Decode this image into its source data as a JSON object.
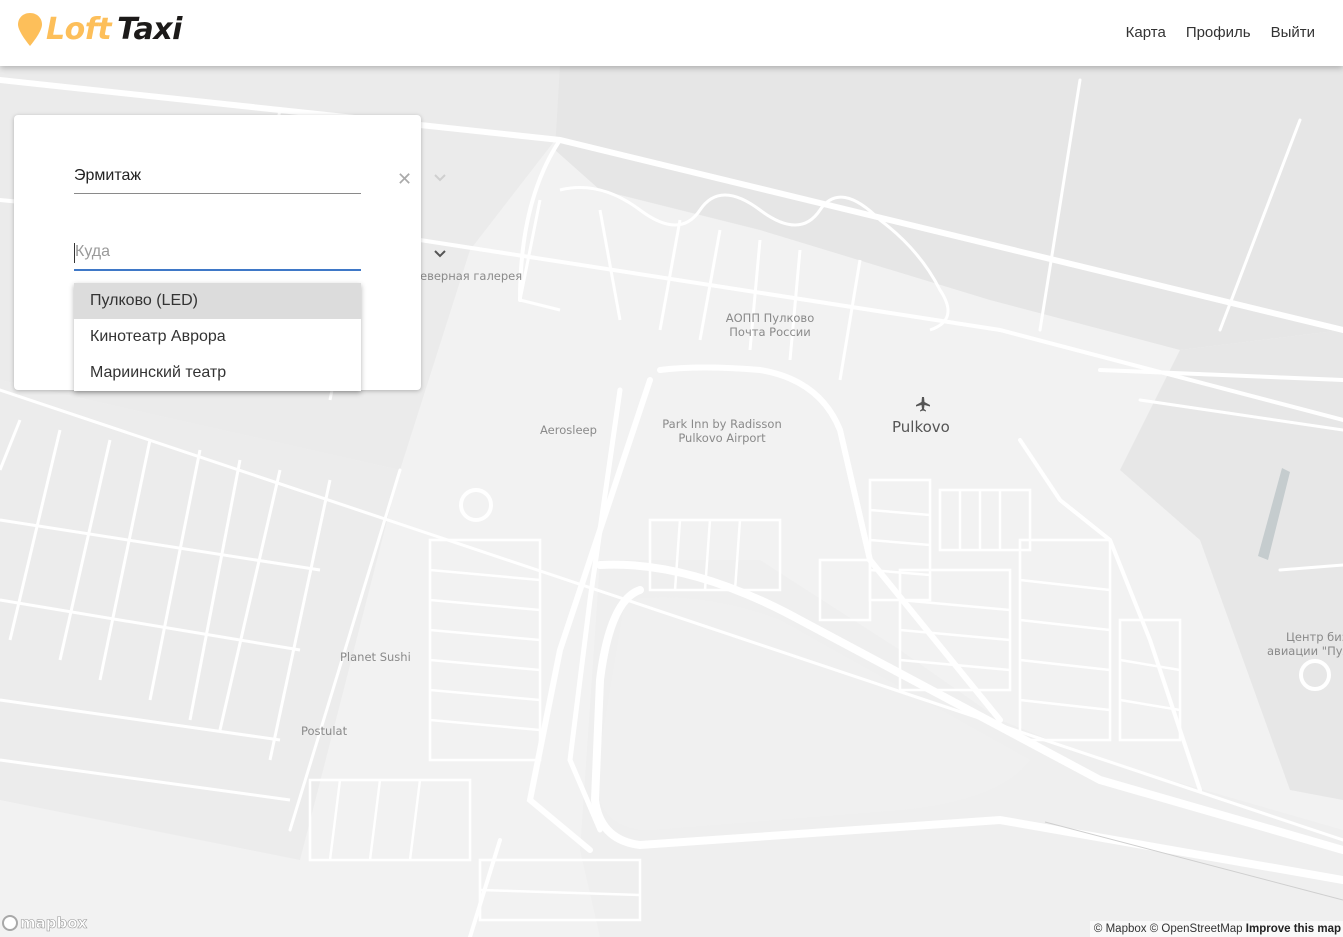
{
  "header": {
    "logo": {
      "loft": "Loft",
      "taxi": "Taxi"
    },
    "nav": [
      {
        "label": "Карта"
      },
      {
        "label": "Профиль"
      },
      {
        "label": "Выйти"
      }
    ]
  },
  "order": {
    "from_value": "Эрмитаж",
    "to_placeholder": "Куда",
    "suggestions": [
      "Пулково (LED)",
      "Кинотеатр Аврора",
      "Мариинский театр"
    ]
  },
  "map": {
    "labels": {
      "gallery": "еверная галерея",
      "post_office_line1": "АОПП Пулково",
      "post_office_line2": "Почта России",
      "airport": "Pulkovo",
      "park_inn_line1": "Park Inn by Radisson",
      "park_inn_line2": "Pulkovo Airport",
      "aerosleep": "Aerosleep",
      "planet_sushi": "Planet Sushi",
      "postulat": "Postulat",
      "business_line1": "Центр бизн",
      "business_line2": "авиации \"Пулк"
    },
    "mapbox_logo": "mapbox",
    "attribution": {
      "mapbox": "© Mapbox",
      "osm": "© OpenStreetMap",
      "improve": "Improve this map"
    }
  },
  "colors": {
    "accent": "#fdbf5a",
    "input_active": "#3f78c7",
    "selected_item": "#dcdcdc"
  }
}
